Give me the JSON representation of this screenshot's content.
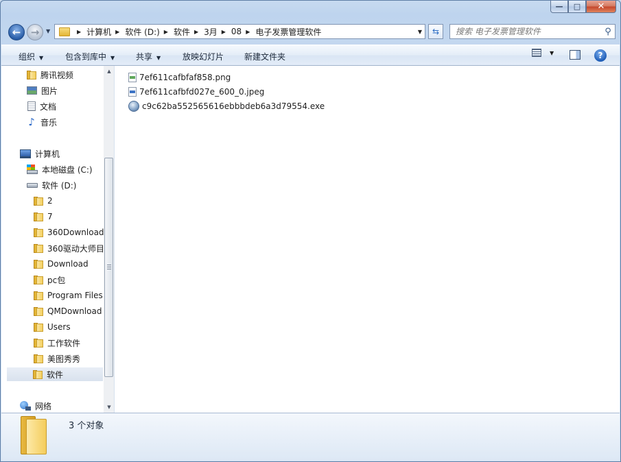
{
  "titlebar": {
    "minimize_glyph": "—",
    "maximize_glyph": "□",
    "close_glyph": "✕"
  },
  "navigation": {
    "back_glyph": "←",
    "forward_glyph": "→"
  },
  "address_bar": {
    "breadcrumbs": [
      "计算机",
      "软件 (D:)",
      "软件",
      "3月",
      "08",
      "电子发票管理软件"
    ]
  },
  "search": {
    "placeholder": "搜索 电子发票管理软件"
  },
  "toolbar": {
    "organize": "组织",
    "include_in_library": "包含到库中",
    "share": "共享",
    "slideshow": "放映幻灯片",
    "new_folder": "新建文件夹"
  },
  "sidebar": {
    "favorites": [
      {
        "label": "腾讯视频",
        "icon": "folder-icon"
      },
      {
        "label": "图片",
        "icon": "pictures-icon"
      },
      {
        "label": "文档",
        "icon": "documents-icon"
      },
      {
        "label": "音乐",
        "icon": "music-icon"
      }
    ],
    "computer": "计算机",
    "drive_c": "本地磁盘 (C:)",
    "drive_d": "软件 (D:)",
    "folders": [
      "2",
      "7",
      "360Download",
      "360驱动大师目",
      "Download",
      "pc包",
      "Program Files",
      "QMDownload",
      "Users",
      "工作软件",
      "美图秀秀",
      "软件"
    ],
    "selected_folder": "软件",
    "network": "网络"
  },
  "files": [
    {
      "name": "7ef611cafbfaf858.png",
      "icon": "png-file-icon"
    },
    {
      "name": "7ef611cafbfd027e_600_0.jpeg",
      "icon": "jpeg-file-icon"
    },
    {
      "name": "c9c62ba552565616ebbbdeb6a3d79554.exe",
      "icon": "exe-file-icon"
    }
  ],
  "details": {
    "item_count": "3 个对象"
  }
}
